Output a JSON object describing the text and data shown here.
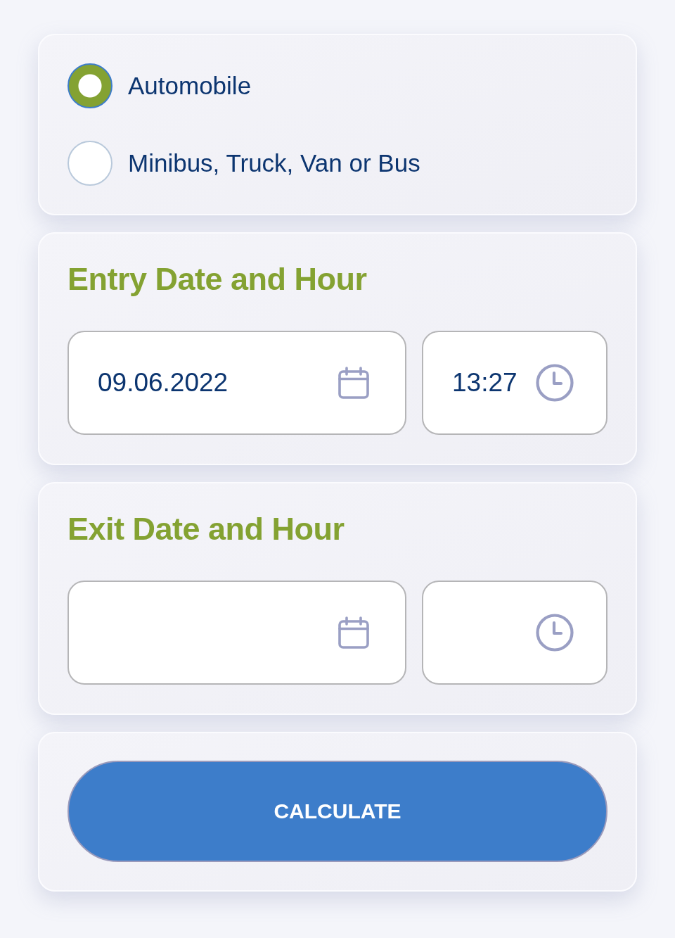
{
  "vehicle_type": {
    "options": [
      {
        "label": "Automobile",
        "selected": true
      },
      {
        "label": "Minibus, Truck, Van or Bus",
        "selected": false
      }
    ]
  },
  "sections": [
    {
      "title": "Entry Date and Hour",
      "fields": [
        {
          "kind": "date",
          "value": "09.06.2022"
        },
        {
          "kind": "time",
          "value": "13:27"
        }
      ]
    },
    {
      "title": "Exit Date and Hour",
      "fields": [
        {
          "kind": "date"
        },
        {
          "kind": "time"
        }
      ]
    }
  ],
  "calculate_button": {
    "label": "CALCULATE"
  }
}
